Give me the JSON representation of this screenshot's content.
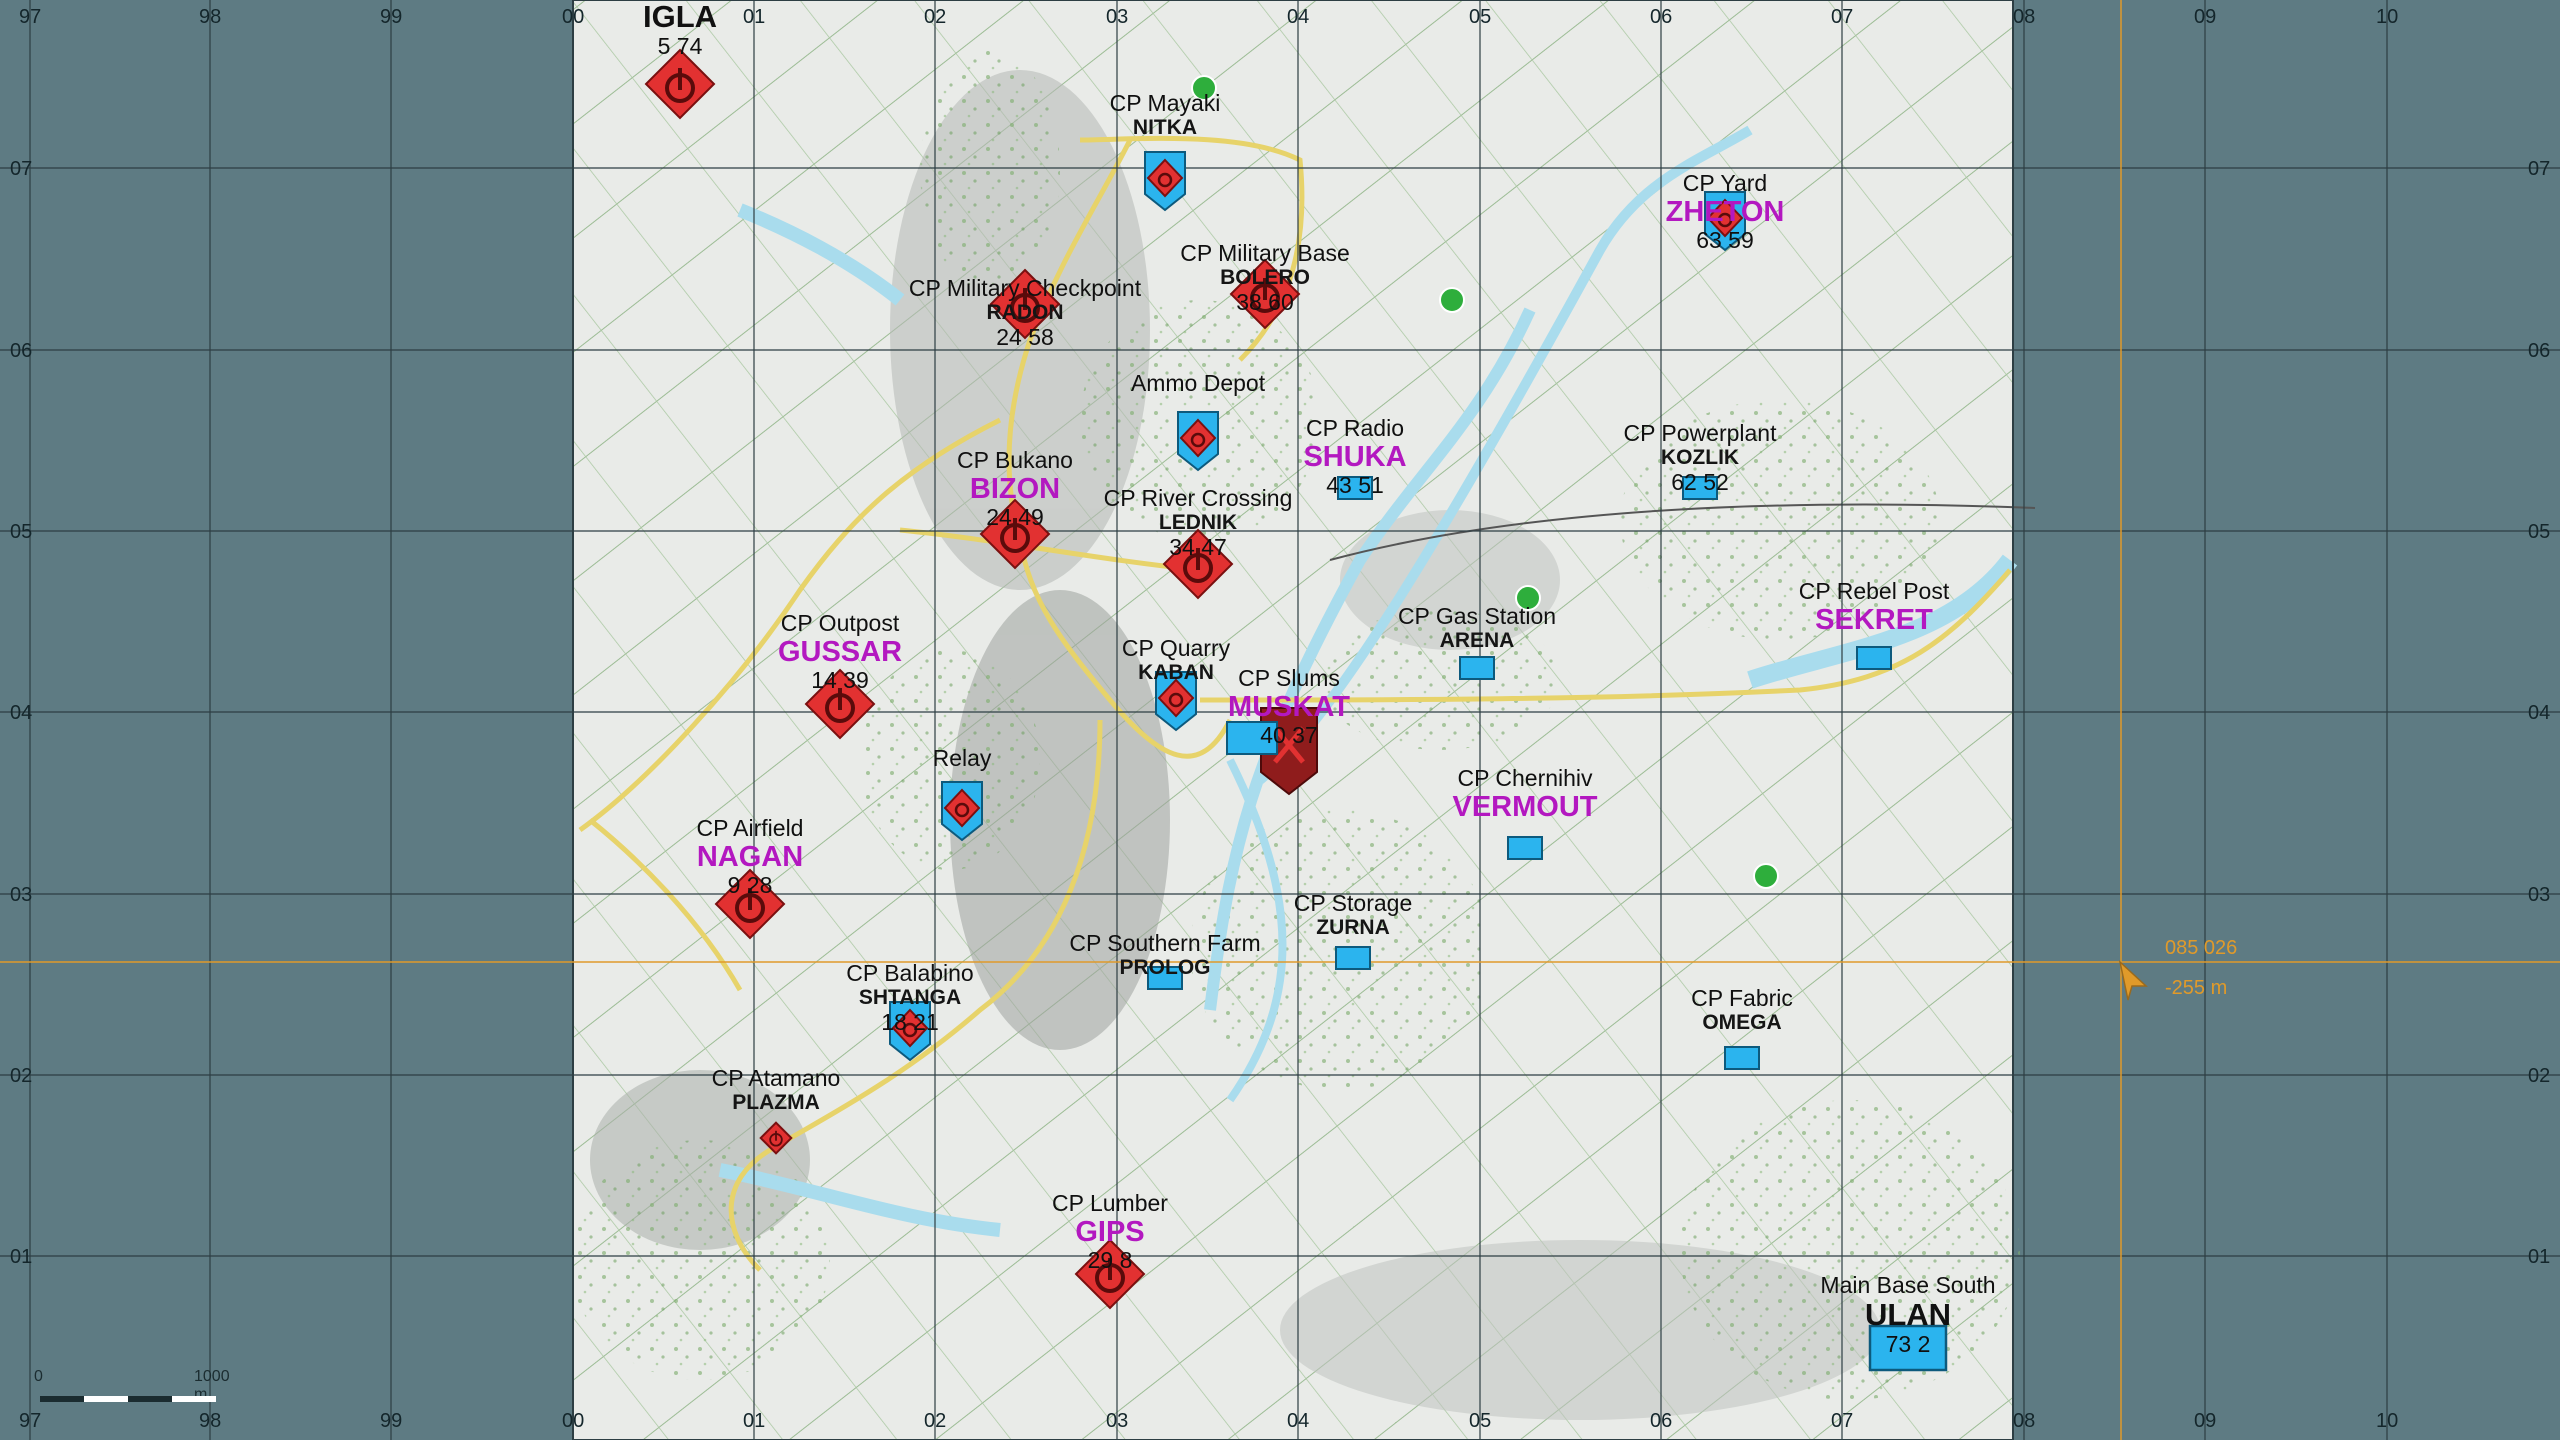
{
  "grid": {
    "x_labels": [
      "97",
      "98",
      "99",
      "00",
      "01",
      "02",
      "03",
      "04",
      "05",
      "06",
      "07",
      "08",
      "09",
      "10"
    ],
    "y_labels": [
      "07",
      "06",
      "05",
      "04",
      "03",
      "02",
      "01"
    ]
  },
  "scale": {
    "zero": "0",
    "end": "1000 m"
  },
  "cursor": {
    "grid": "085 026",
    "distance": "-255 m"
  },
  "colors": {
    "background": "#5e7b83",
    "friendly": "#2bb4ee",
    "enemy": "#e23131",
    "enemy_dark": "#8f1c1c",
    "callsign_special": "#b318c0",
    "cursor": "#e09a2a",
    "road": "#e7d36a",
    "water": "#a9dced",
    "forest": "#5d9a4b"
  },
  "markers": [
    {
      "name": "",
      "callsign": "IGLA",
      "special": false,
      "count": "5 74",
      "icon": "enemy-hq-icon"
    },
    {
      "name": "CP Mayaki",
      "callsign": "NITKA",
      "special": false,
      "count": "",
      "icon": "friendly-contested-icon"
    },
    {
      "name": "CP Yard",
      "callsign": "ZHETON",
      "special": true,
      "count": "63 59",
      "icon": "friendly-contested-icon"
    },
    {
      "name": "CP Military Base",
      "callsign": "BOLERO",
      "special": false,
      "count": "38 60",
      "icon": "enemy-hq-icon"
    },
    {
      "name": "CP Military Checkpoint",
      "callsign": "RADON",
      "special": false,
      "count": "24 58",
      "icon": "enemy-hq-icon"
    },
    {
      "name": "Ammo Depot",
      "callsign": "",
      "special": false,
      "count": "",
      "icon": "friendly-contested-icon"
    },
    {
      "name": "CP Radio",
      "callsign": "SHUKA",
      "special": true,
      "count": "43 51",
      "icon": "friendly-unit-icon"
    },
    {
      "name": "CP Powerplant",
      "callsign": "KOZLIK",
      "special": false,
      "count": "62 52",
      "icon": "friendly-unit-icon"
    },
    {
      "name": "CP Bukano",
      "callsign": "BIZON",
      "special": true,
      "count": "24 49",
      "icon": "enemy-hq-icon"
    },
    {
      "name": "CP River Crossing",
      "callsign": "LEDNIK",
      "special": false,
      "count": "34 47",
      "icon": "enemy-hq-icon"
    },
    {
      "name": "CP Rebel Post",
      "callsign": "SEKRET",
      "special": true,
      "count": "",
      "icon": "friendly-unit-icon"
    },
    {
      "name": "CP Gas Station",
      "callsign": "ARENA",
      "special": false,
      "count": "",
      "icon": "friendly-unit-icon"
    },
    {
      "name": "CP Outpost",
      "callsign": "GUSSAR",
      "special": true,
      "count": "14 39",
      "icon": "enemy-hq-icon"
    },
    {
      "name": "CP Quarry",
      "callsign": "KABAN",
      "special": false,
      "count": "",
      "icon": "friendly-contested-icon"
    },
    {
      "name": "CP Slums",
      "callsign": "MUSKAT",
      "special": true,
      "count": "40 37",
      "icon": "enemy-attack-icon"
    },
    {
      "name": "Relay",
      "callsign": "",
      "special": false,
      "count": "",
      "icon": "friendly-contested-icon"
    },
    {
      "name": "CP Chernihiv",
      "callsign": "VERMOUT",
      "special": true,
      "count": "",
      "icon": "friendly-unit-icon"
    },
    {
      "name": "CP Airfield",
      "callsign": "NAGAN",
      "special": true,
      "count": "9 28",
      "icon": "enemy-hq-icon"
    },
    {
      "name": "CP Storage",
      "callsign": "ZURNA",
      "special": false,
      "count": "",
      "icon": "friendly-unit-icon"
    },
    {
      "name": "CP Southern Farm",
      "callsign": "PROLOG",
      "special": false,
      "count": "",
      "icon": "friendly-unit-icon"
    },
    {
      "name": "CP Balabino",
      "callsign": "SHTANGA",
      "special": false,
      "count": "18 21",
      "icon": "friendly-contested-icon"
    },
    {
      "name": "CP Fabric",
      "callsign": "OMEGA",
      "special": false,
      "count": "",
      "icon": "friendly-unit-icon"
    },
    {
      "name": "CP Atamano",
      "callsign": "PLAZMA",
      "special": false,
      "count": "",
      "icon": "enemy-small-icon"
    },
    {
      "name": "CP Lumber",
      "callsign": "GIPS",
      "special": true,
      "count": "29 8",
      "icon": "enemy-hq-icon"
    },
    {
      "name": "Main Base South",
      "callsign": "ULAN",
      "special": false,
      "count": "73 2",
      "icon": "friendly-base-icon"
    }
  ]
}
